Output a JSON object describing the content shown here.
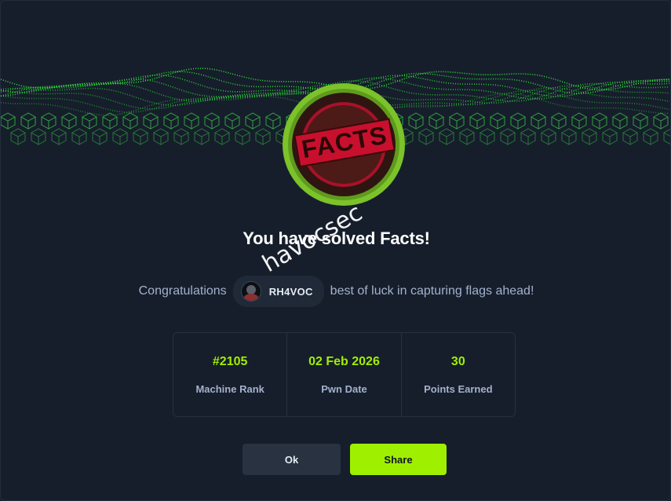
{
  "hero": {
    "icon": "green-wave-grid-banner"
  },
  "badge": {
    "text": "FACTS",
    "icon": "facts-machine-badge",
    "ring_color": "#8ac926",
    "stamp_color": "#c8102e"
  },
  "title": "You have solved Facts!",
  "congrats": {
    "prefix": "Congratulations",
    "username": "RH4VOC",
    "suffix": "best of luck in capturing flags ahead!"
  },
  "watermark": "havocsec",
  "stats": [
    {
      "value": "#2105",
      "label": "Machine Rank"
    },
    {
      "value": "02 Feb 2026",
      "label": "Pwn Date"
    },
    {
      "value": "30",
      "label": "Points Earned"
    }
  ],
  "buttons": {
    "ok": "Ok",
    "share": "Share"
  },
  "colors": {
    "accent": "#9fef00",
    "background": "#161e2b",
    "muted_text": "#a4b1cd"
  }
}
